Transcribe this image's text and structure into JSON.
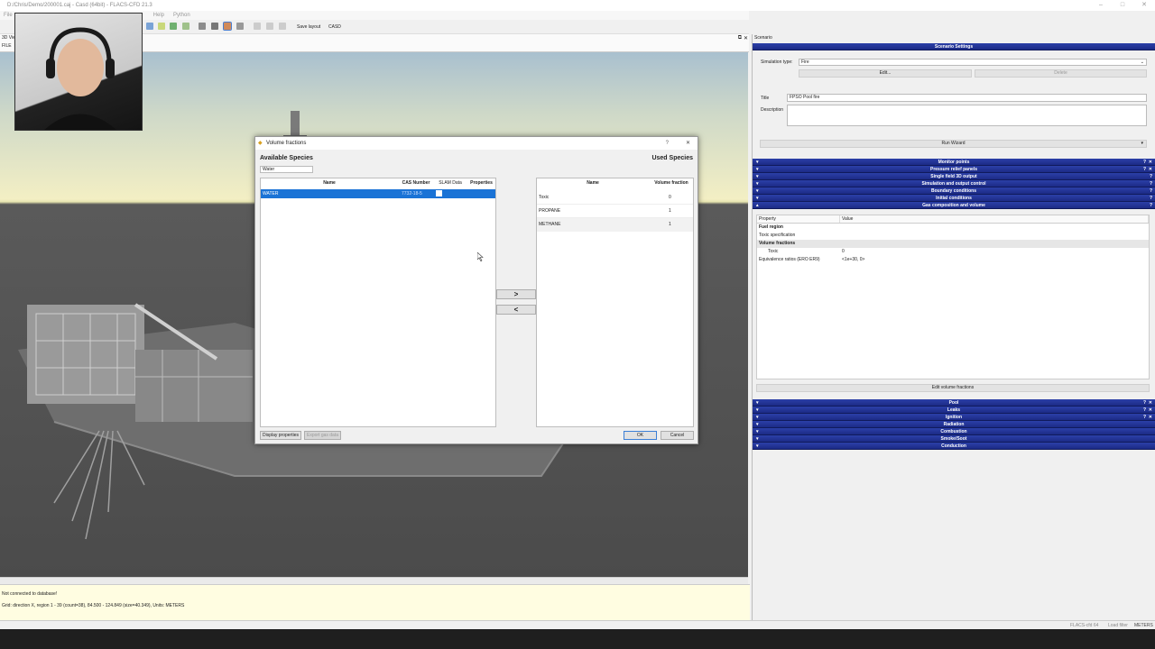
{
  "window": {
    "title": "D:/Chris/Demo/200001.caj - Casd (64bit) - FLACS-CFD 21.3",
    "controls": [
      "–",
      "□",
      "✕"
    ]
  },
  "menu": [
    "File",
    "Help",
    "Python"
  ],
  "toolbar": {
    "save_layout": "Save layout",
    "casd": "CASD"
  },
  "view": {
    "label": "3D View",
    "file_label": "FILE"
  },
  "status": {
    "db": "Not connected to database!",
    "grid": "Grid: direction X, region 1 - 39 (count=38), 84.500 - 124.849 (size=40.349), Units: METERS",
    "version": "FLACS-cfd 64",
    "filter": "Load filter",
    "units": "METERS"
  },
  "scenario": {
    "header": "Scenario",
    "settings_title": "Scenario Settings",
    "sim_type_label": "Simulation type:",
    "sim_type_value": "Fire",
    "edit_btn": "Edit...",
    "delete_btn": "Delete",
    "title_label": "Title",
    "title_value": "FPSO Pool fire",
    "description_label": "Description",
    "run_wizard": "Run Wizard",
    "sections_top": [
      "Monitor points",
      "Pressure relief panels",
      "Single field 3D output",
      "Simulation and output control",
      "Boundary conditions",
      "Initial conditions",
      "Gas composition and volume"
    ],
    "prop_header": {
      "property": "Property",
      "value": "Value"
    },
    "prop_rows": [
      {
        "name": "Fuel region",
        "value": "",
        "bold": true
      },
      {
        "name": "Toxic specification",
        "value": ""
      },
      {
        "name": "Volume fractions",
        "value": "",
        "bold": true
      },
      {
        "name": "Toxic",
        "value": "0",
        "indent": true
      },
      {
        "name": "Equivalence ratios (ERO ER9)",
        "value": "<1e+30, 0>"
      }
    ],
    "edit_volume_btn": "Edit volume fractions",
    "sections_bottom": [
      "Pool",
      "Leaks",
      "Ignition",
      "Radiation",
      "Combustion",
      "Smoke/Soot",
      "Conduction"
    ]
  },
  "dialog": {
    "title": "Volume fractions",
    "help": "?",
    "close": "✕",
    "available_title": "Available Species",
    "search_value": "Water",
    "available_columns": [
      "Name",
      "CAS Number",
      "SLAM Data",
      "Properties"
    ],
    "available_rows": [
      {
        "name": "WATER",
        "cas": "7732-18-5",
        "slam": "",
        "props": ""
      }
    ],
    "used_title": "Used Species",
    "used_columns": [
      "Name",
      "Volume fraction"
    ],
    "used_rows": [
      {
        "name": "Toxic",
        "fraction": "0"
      },
      {
        "name": "PROPANE",
        "fraction": "1"
      },
      {
        "name": "METHANE",
        "fraction": "1"
      }
    ],
    "move_right": ">",
    "move_left": "<",
    "display_props_btn": "Display properties",
    "export_gas_btn": "Export gas data",
    "ok_btn": "OK",
    "cancel_btn": "Cancel"
  }
}
